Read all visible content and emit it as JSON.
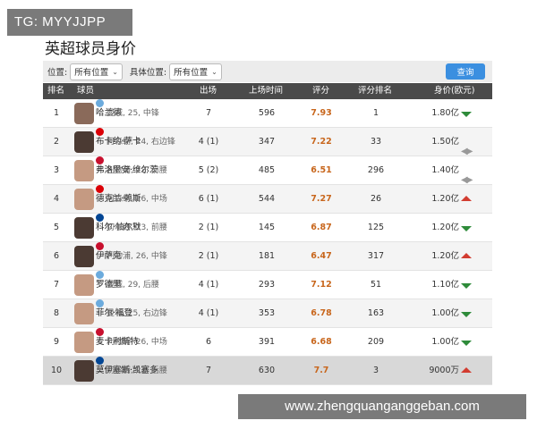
{
  "watermark_top": "TG: MYYJJPP",
  "watermark_bottom": "www.zhengquanganggeban.com",
  "title": "英超球员身价",
  "filters": {
    "position_label": "位置:",
    "position_value": "所有位置",
    "detail_label": "具体位置:",
    "detail_value": "所有位置",
    "query_label": "查询"
  },
  "columns": {
    "rank": "排名",
    "player": "球员",
    "apps": "出场",
    "mins": "上场时间",
    "rating": "评分",
    "rating_rank": "评分排名",
    "value": "身价(欧元)"
  },
  "colors": {
    "up": "#d23c30",
    "down": "#2e8b3a",
    "rating": "#c8661c",
    "query": "#3b8fe0"
  },
  "rows": [
    {
      "rank": "1",
      "name": "哈兰德",
      "info": "曼城, 25, 中锋",
      "club_color": "#6cabdd",
      "apps": "7",
      "mins": "596",
      "rating": "7.93",
      "rating_rank": "1",
      "value": "1.80亿",
      "trend": "down"
    },
    {
      "rank": "2",
      "name": "布卡约·萨卡",
      "info": "阿森纳, 24, 右边锋",
      "club_color": "#db0007",
      "apps": "4 (1)",
      "mins": "347",
      "rating": "7.22",
      "rating_rank": "33",
      "value": "1.50亿",
      "trend": "flat"
    },
    {
      "rank": "3",
      "name": "弗洛里安·维尔茨",
      "info": "利物浦, 22, 前腰",
      "club_color": "#c8102e",
      "apps": "5 (2)",
      "mins": "485",
      "rating": "6.51",
      "rating_rank": "296",
      "value": "1.40亿",
      "trend": "flat"
    },
    {
      "rank": "4",
      "name": "德克兰·赖斯",
      "info": "阿森纳, 26, 中场",
      "club_color": "#db0007",
      "apps": "6 (1)",
      "mins": "544",
      "rating": "7.27",
      "rating_rank": "26",
      "value": "1.20亿",
      "trend": "up"
    },
    {
      "rank": "5",
      "name": "科尔·帕尔默",
      "info": "切尔西, 23, 前腰",
      "club_color": "#034694",
      "apps": "2 (1)",
      "mins": "145",
      "rating": "6.87",
      "rating_rank": "125",
      "value": "1.20亿",
      "trend": "down"
    },
    {
      "rank": "6",
      "name": "伊萨克",
      "info": "利物浦, 26, 中锋",
      "club_color": "#c8102e",
      "apps": "2 (1)",
      "mins": "181",
      "rating": "6.47",
      "rating_rank": "317",
      "value": "1.20亿",
      "trend": "up"
    },
    {
      "rank": "7",
      "name": "罗德里",
      "info": "曼城, 29, 后腰",
      "club_color": "#6cabdd",
      "apps": "4 (1)",
      "mins": "293",
      "rating": "7.12",
      "rating_rank": "51",
      "value": "1.10亿",
      "trend": "down"
    },
    {
      "rank": "8",
      "name": "菲尔·福登",
      "info": "曼城, 25, 右边锋",
      "club_color": "#6cabdd",
      "apps": "4 (1)",
      "mins": "353",
      "rating": "6.78",
      "rating_rank": "163",
      "value": "1.00亿",
      "trend": "down"
    },
    {
      "rank": "9",
      "name": "麦卡利斯特",
      "info": "利物浦, 26, 中场",
      "club_color": "#c8102e",
      "apps": "6",
      "mins": "391",
      "rating": "6.68",
      "rating_rank": "209",
      "value": "1.00亿",
      "trend": "down"
    },
    {
      "rank": "10",
      "name": "莫伊塞斯·凯塞多",
      "info": "切尔西, 23, 后腰",
      "club_color": "#034694",
      "apps": "7",
      "mins": "630",
      "rating": "7.7",
      "rating_rank": "3",
      "value": "9000万",
      "trend": "up"
    }
  ]
}
